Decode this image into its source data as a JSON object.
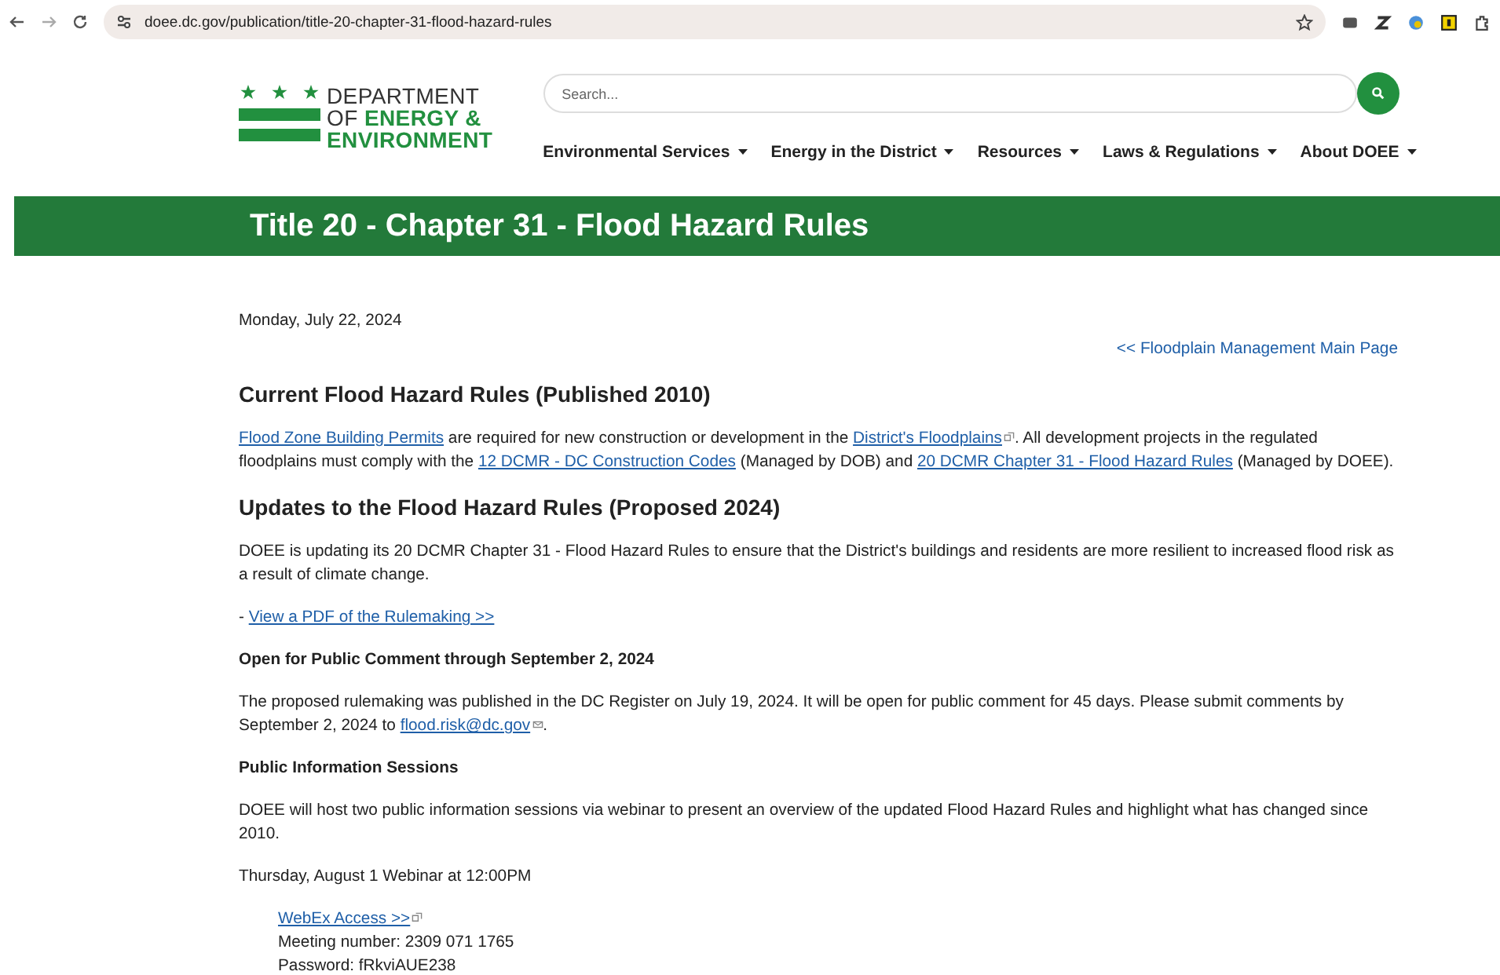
{
  "browser": {
    "url": "doee.dc.gov/publication/title-20-chapter-31-flood-hazard-rules"
  },
  "logo": {
    "lines": [
      [
        {
          "text": "DEPARTMENT",
          "accent": false
        }
      ],
      [
        {
          "text": "OF ",
          "accent": false
        },
        {
          "text": "ENERGY &",
          "accent": true
        }
      ],
      [
        {
          "text": "ENVIRONMENT",
          "accent": true
        }
      ]
    ]
  },
  "search": {
    "placeholder": "Search..."
  },
  "nav": [
    "Environmental Services",
    "Energy in the District",
    "Resources",
    "Laws & Regulations",
    "About DOEE"
  ],
  "banner": {
    "title": "Title 20 - Chapter 31 - Flood Hazard Rules"
  },
  "content": {
    "date": "Monday, July 22, 2024",
    "back_link": "<< Floodplain Management Main Page",
    "blocks": [
      {
        "kind": "heading",
        "segments": [
          {
            "text": "Current Flood Hazard Rules (Published 2010)"
          }
        ]
      },
      {
        "kind": "paragraph",
        "segments": [
          {
            "text": "Flood Zone Building Permits",
            "link": true,
            "external": false
          },
          {
            "text": " are required for new construction or development in the "
          },
          {
            "text": "District's Floodplains",
            "link": true,
            "external": true
          },
          {
            "text": ". All development projects in the regulated floodplains must comply with the "
          },
          {
            "text": "12 DCMR - DC Construction Codes",
            "link": true,
            "external": false
          },
          {
            "text": " (Managed by DOB) and "
          },
          {
            "text": "20 DCMR Chapter 31 - Flood Hazard Rules",
            "link": true,
            "external": false
          },
          {
            "text": " (Managed by DOEE)."
          }
        ]
      },
      {
        "kind": "heading",
        "segments": [
          {
            "text": "Updates to the Flood Hazard Rules (Proposed 2024)"
          }
        ]
      },
      {
        "kind": "paragraph",
        "segments": [
          {
            "text": "DOEE is updating its 20 DCMR Chapter 31 - Flood Hazard Rules to ensure that the District's buildings and residents are more resilient to increased flood risk as a result of climate change."
          }
        ]
      },
      {
        "kind": "paragraph",
        "segments": [
          {
            "text": "- "
          },
          {
            "text": "View a PDF of the Rulemaking >>",
            "link": true,
            "external": false
          }
        ]
      },
      {
        "kind": "subheading",
        "segments": [
          {
            "text": "Open for Public Comment through September 2, 2024"
          }
        ]
      },
      {
        "kind": "paragraph",
        "segments": [
          {
            "text": "The proposed rulemaking was published in the DC Register on July 19, 2024.  It will be open for public comment for 45 days. Please submit comments by September 2, 2024 to "
          },
          {
            "text": "flood.risk@dc.gov",
            "link": true,
            "external": false,
            "mail": true
          },
          {
            "text": "."
          }
        ]
      },
      {
        "kind": "subheading",
        "segments": [
          {
            "text": "Public Information Sessions"
          }
        ]
      },
      {
        "kind": "paragraph",
        "segments": [
          {
            "text": "DOEE will host two public information sessions via webinar to present an overview of the updated Flood Hazard Rules and highlight what has changed since 2010."
          }
        ]
      },
      {
        "kind": "paragraph",
        "segments": [
          {
            "text": "Thursday, August 1 Webinar at 12:00PM"
          }
        ]
      },
      {
        "kind": "indented",
        "segments": [
          {
            "text": "WebEx Access >>",
            "link": true,
            "external": true
          }
        ]
      },
      {
        "kind": "indented",
        "segments": [
          {
            "text": "Meeting number: 2309 071 1765"
          }
        ]
      },
      {
        "kind": "indented",
        "segments": [
          {
            "text": "Password: fRkviAUE238"
          }
        ]
      }
    ]
  }
}
